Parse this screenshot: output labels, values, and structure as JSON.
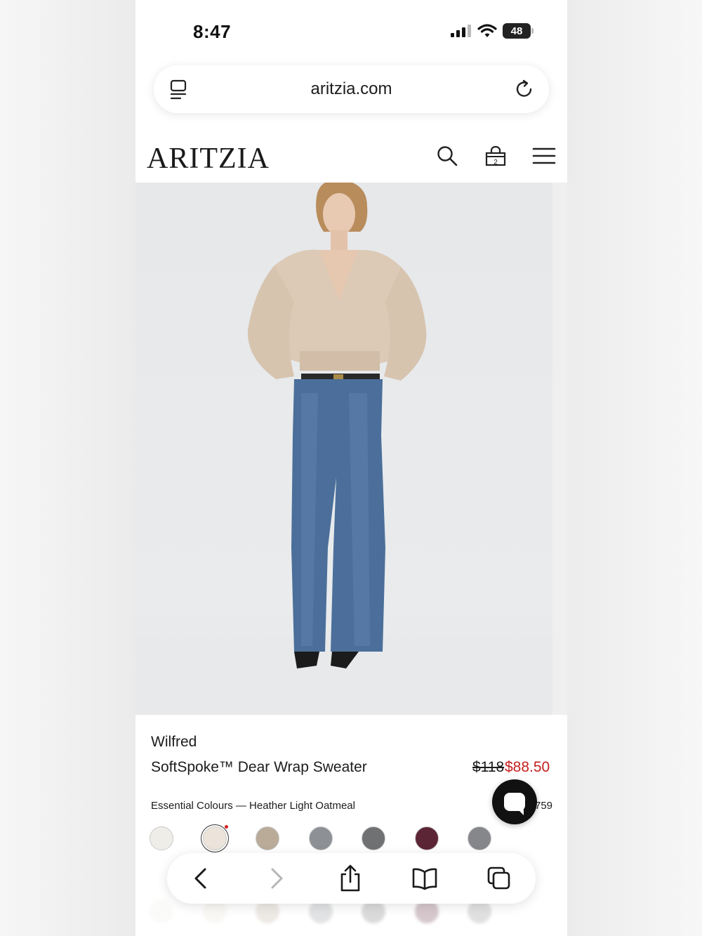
{
  "status_bar": {
    "time": "8:47",
    "battery": "48"
  },
  "browser": {
    "url": "aritzia.com"
  },
  "site": {
    "logo": "ARITZIA",
    "bag_count": "2"
  },
  "product": {
    "brand": "Wilfred",
    "name": "SoftSpoke™ Dear Wrap Sweater",
    "price_original": "$118",
    "price_sale": "$88.50",
    "colour_label": "Essential Colours — Heather Light Oatmeal",
    "colour_count": "759"
  },
  "swatches": [
    {
      "name": "white",
      "color": "#efede8"
    },
    {
      "name": "heather-light-oatmeal",
      "color": "#ece4da",
      "selected": true,
      "new": true
    },
    {
      "name": "taupe",
      "color": "#b9ab98"
    },
    {
      "name": "grey",
      "color": "#8d9196"
    },
    {
      "name": "charcoal",
      "color": "#6f7173"
    },
    {
      "name": "burgundy",
      "color": "#5c2535"
    },
    {
      "name": "dark-grey",
      "color": "#85878a"
    }
  ],
  "colors": {
    "sale_red": "#c41e1e",
    "text": "#1c1c1c"
  }
}
